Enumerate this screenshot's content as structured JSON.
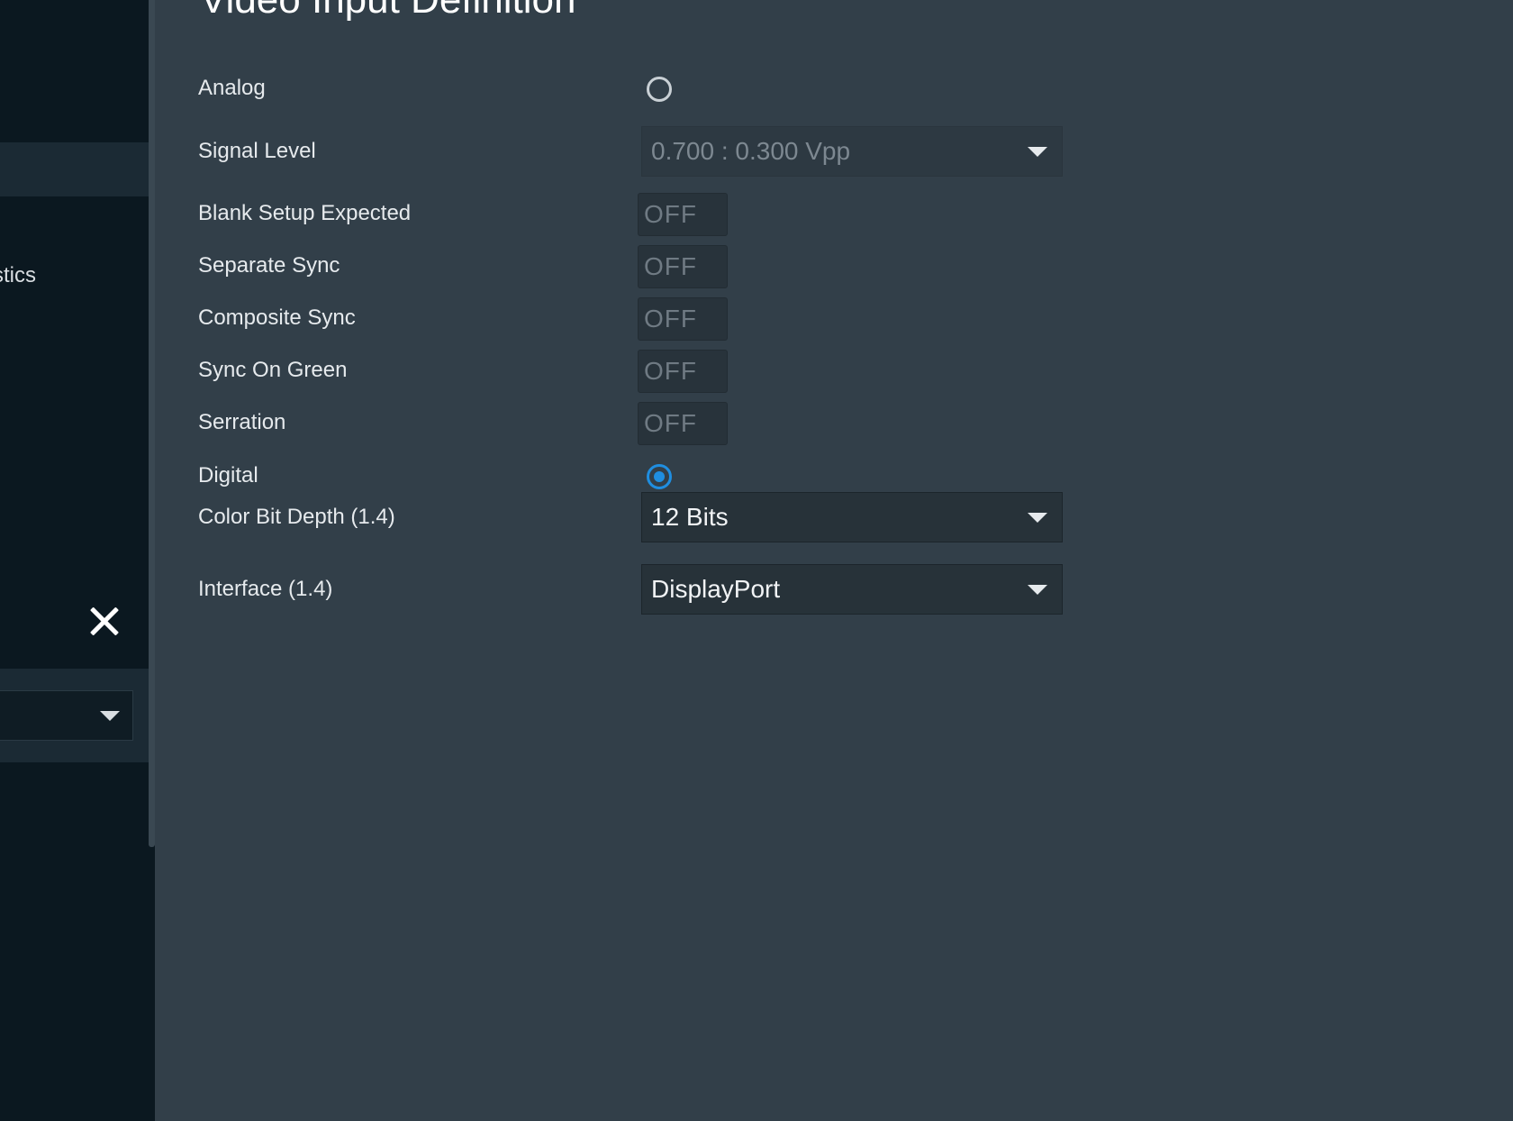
{
  "sidebar": {
    "partial_label": "stics"
  },
  "page": {
    "title": "Video Input Definition"
  },
  "analog": {
    "label": "Analog",
    "selected": false
  },
  "signal_level": {
    "label": "Signal Level",
    "value": "0.700 : 0.300 Vpp",
    "disabled": true
  },
  "blank_setup": {
    "label": "Blank Setup Expected",
    "state": "OFF"
  },
  "separate_sync": {
    "label": "Separate Sync",
    "state": "OFF"
  },
  "composite_sync": {
    "label": "Composite Sync",
    "state": "OFF"
  },
  "sync_on_green": {
    "label": "Sync On Green",
    "state": "OFF"
  },
  "serration": {
    "label": "Serration",
    "state": "OFF"
  },
  "digital": {
    "label": "Digital",
    "selected": true
  },
  "color_bit_depth": {
    "label": "Color Bit Depth (1.4)",
    "value": "12 Bits"
  },
  "interface": {
    "label": "Interface (1.4)",
    "value": "DisplayPort"
  },
  "colors": {
    "panel_bg": "#323f49",
    "sidebar_bg": "#0b1820",
    "radio_selected": "#1f8ee0"
  },
  "icons": {
    "close": "close-icon",
    "dropdown_caret": "chevron-down-icon"
  }
}
